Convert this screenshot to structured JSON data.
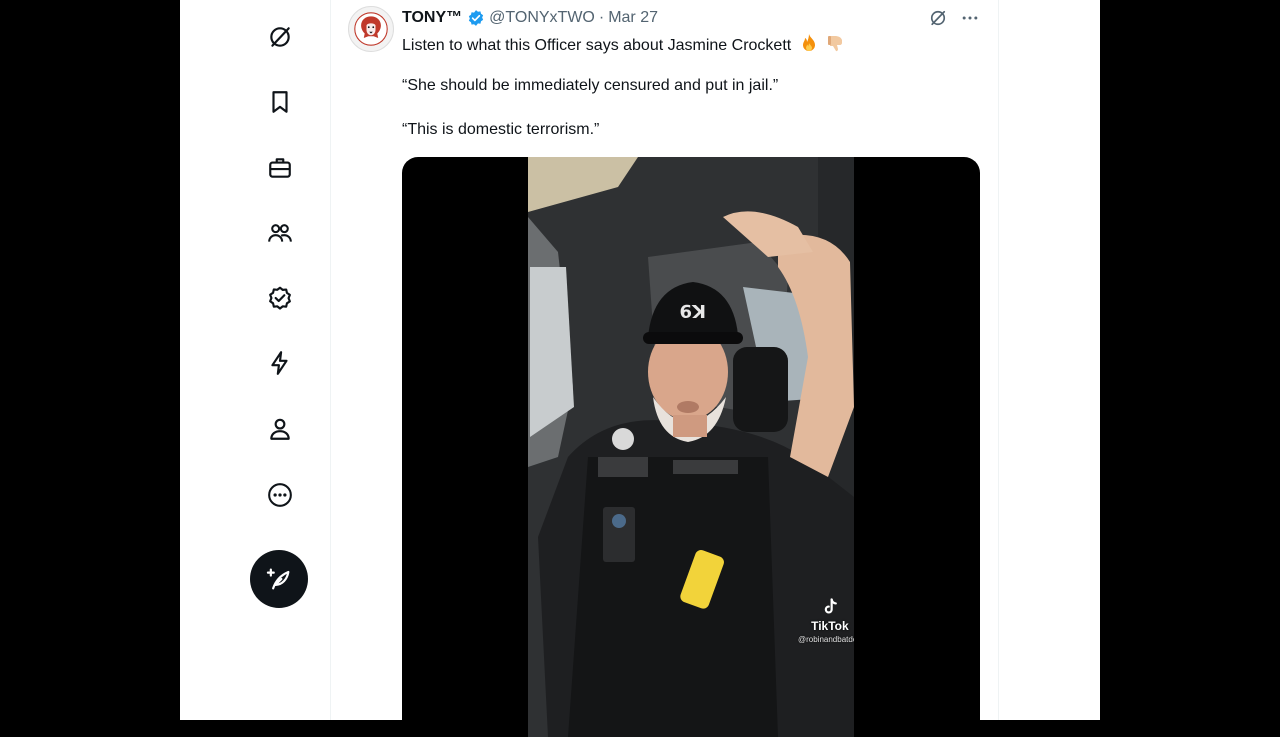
{
  "nav": {
    "items": [
      {
        "icon": "grok-icon"
      },
      {
        "icon": "bookmark-icon"
      },
      {
        "icon": "briefcase-icon"
      },
      {
        "icon": "communities-icon"
      },
      {
        "icon": "verified-icon"
      },
      {
        "icon": "lightning-icon"
      },
      {
        "icon": "profile-icon"
      },
      {
        "icon": "more-icon"
      }
    ],
    "post_button_icon": "compose-icon"
  },
  "tweet": {
    "display_name": "TONY™",
    "handle": "@TONYxTWO",
    "separator": "·",
    "date": "Mar 27",
    "line1": "Listen to what this Officer says about Jasmine Crockett",
    "line1_emojis": [
      "fire-emoji",
      "thumbs-down-emoji"
    ],
    "quote1": "“She should be immediately censured and put in jail.”",
    "quote2": "“This is domestic terrorism.”",
    "media": {
      "watermark_brand": "TikTok",
      "watermark_user": "@robinandbatdog"
    }
  },
  "colors": {
    "accent": "#1d9bf0",
    "text_primary": "#0f1419",
    "text_secondary": "#536471",
    "background": "#ffffff",
    "letterbox": "#000000"
  }
}
